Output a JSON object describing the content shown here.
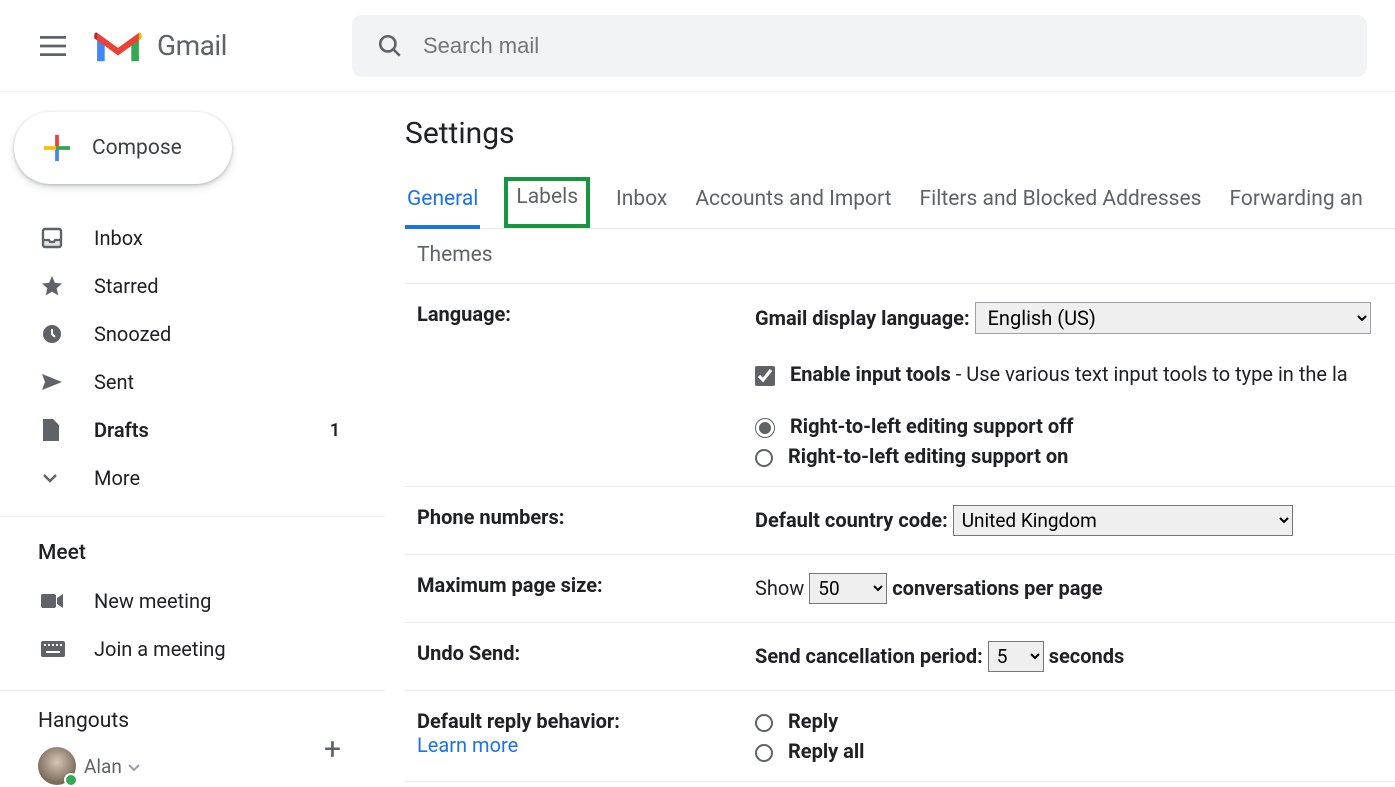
{
  "header": {
    "app_name": "Gmail",
    "search_placeholder": "Search mail"
  },
  "compose_label": "Compose",
  "sidebar": {
    "items": [
      {
        "label": "Inbox"
      },
      {
        "label": "Starred"
      },
      {
        "label": "Snoozed"
      },
      {
        "label": "Sent"
      },
      {
        "label": "Drafts",
        "count": "1"
      },
      {
        "label": "More"
      }
    ],
    "meet_header": "Meet",
    "meet_items": [
      {
        "label": "New meeting"
      },
      {
        "label": "Join a meeting"
      }
    ],
    "hangouts_header": "Hangouts",
    "user_name": "Alan"
  },
  "settings": {
    "title": "Settings",
    "tabs": [
      "General",
      "Labels",
      "Inbox",
      "Accounts and Import",
      "Filters and Blocked Addresses",
      "Forwarding an"
    ],
    "subtab": "Themes",
    "language": {
      "label": "Language:",
      "display_label": "Gmail display language:",
      "display_value": "English (US)",
      "input_tools_label": "Enable input tools",
      "input_tools_desc": " - Use various text input tools to type in the la",
      "rtl_off": "Right-to-left editing support off",
      "rtl_on": "Right-to-left editing support on"
    },
    "phone": {
      "label": "Phone numbers:",
      "cc_label": "Default country code:",
      "cc_value": "United Kingdom"
    },
    "page_size": {
      "label": "Maximum page size:",
      "show": "Show",
      "value": "50",
      "suffix": "conversations per page"
    },
    "undo": {
      "label": "Undo Send:",
      "prefix": "Send cancellation period:",
      "value": "5",
      "suffix": "seconds"
    },
    "reply": {
      "label": "Default reply behavior:",
      "learn_more": "Learn more",
      "reply": "Reply",
      "reply_all": "Reply all"
    }
  }
}
